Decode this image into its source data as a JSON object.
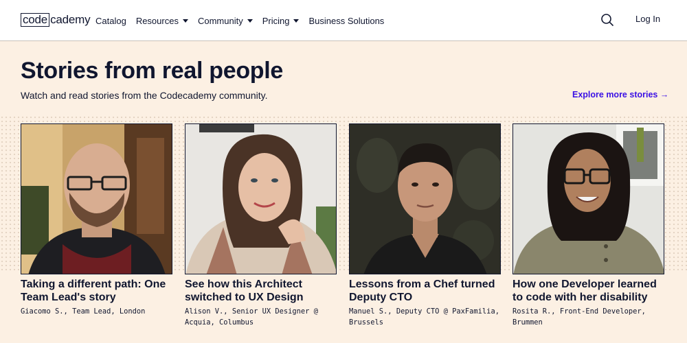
{
  "header": {
    "logo_left": "code",
    "logo_right": "cademy",
    "nav": [
      {
        "label": "Catalog",
        "dropdown": false
      },
      {
        "label": "Resources",
        "dropdown": true
      },
      {
        "label": "Community",
        "dropdown": true
      },
      {
        "label": "Pricing",
        "dropdown": true
      },
      {
        "label": "Business Solutions",
        "dropdown": false
      }
    ],
    "search_icon": "search-icon",
    "login_label": "Log In"
  },
  "hero": {
    "title": "Stories from real people",
    "subtitle": "Watch and read stories from the Codecademy community.",
    "explore_label": "Explore more stories →"
  },
  "stories": [
    {
      "title": "Taking a different path: One Team Lead's story",
      "meta": "Giacomo S., Team Lead, London"
    },
    {
      "title": "See how this Architect switched to UX Design",
      "meta": "Alison V., Senior UX Designer @ Acquia, Columbus"
    },
    {
      "title": "Lessons from a Chef turned Deputy CTO",
      "meta": "Manuel S., Deputy CTO @ PaxFamilia, Brussels"
    },
    {
      "title": "How one Developer learned to code with her disability",
      "meta": "Rosita R., Front-End Developer, Brummen"
    }
  ],
  "colors": {
    "accent": "#3a10e5",
    "navy": "#10162f",
    "background": "#fcf0e3"
  }
}
